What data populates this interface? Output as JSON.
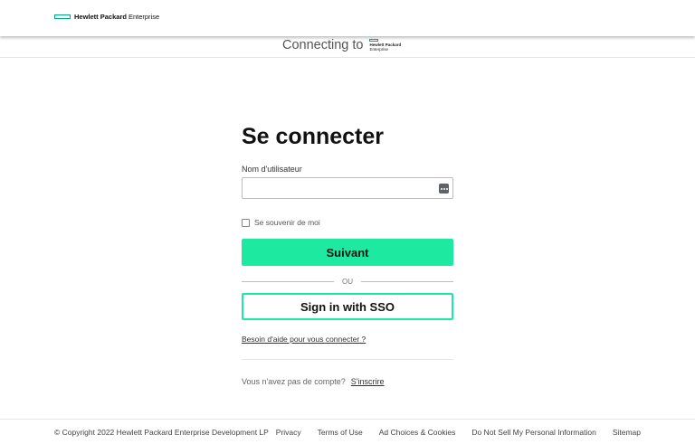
{
  "header": {
    "brand_bold": "Hewlett Packard",
    "brand_light": "Enterprise",
    "accent_color": "#01a982"
  },
  "connecting": {
    "text": "Connecting to",
    "logo_line1": "Hewlett Packard",
    "logo_line2": "Enterprise"
  },
  "form": {
    "title": "Se connecter",
    "username_label": "Nom d'utilisateur",
    "username_value": "",
    "username_placeholder": "",
    "password_manager_icon": "dots-key-icon",
    "remember_label": "Se souvenir de moi",
    "remember_checked": false,
    "next_button": "Suivant",
    "next_button_color": "#1de9a0",
    "or_text": "OU",
    "sso_button": "Sign in with SSO",
    "help_link": "Besoin d'aide pour vous connecter ?",
    "no_account_text": "Vous n'avez pas de compte?",
    "signup_link": "S'inscrire"
  },
  "footer": {
    "copyright": "© Copyright 2022 Hewlett Packard Enterprise Development LP",
    "links": [
      "Privacy",
      "Terms of Use",
      "Ad Choices & Cookies",
      "Do Not Sell My Personal Information",
      "Sitemap"
    ]
  }
}
